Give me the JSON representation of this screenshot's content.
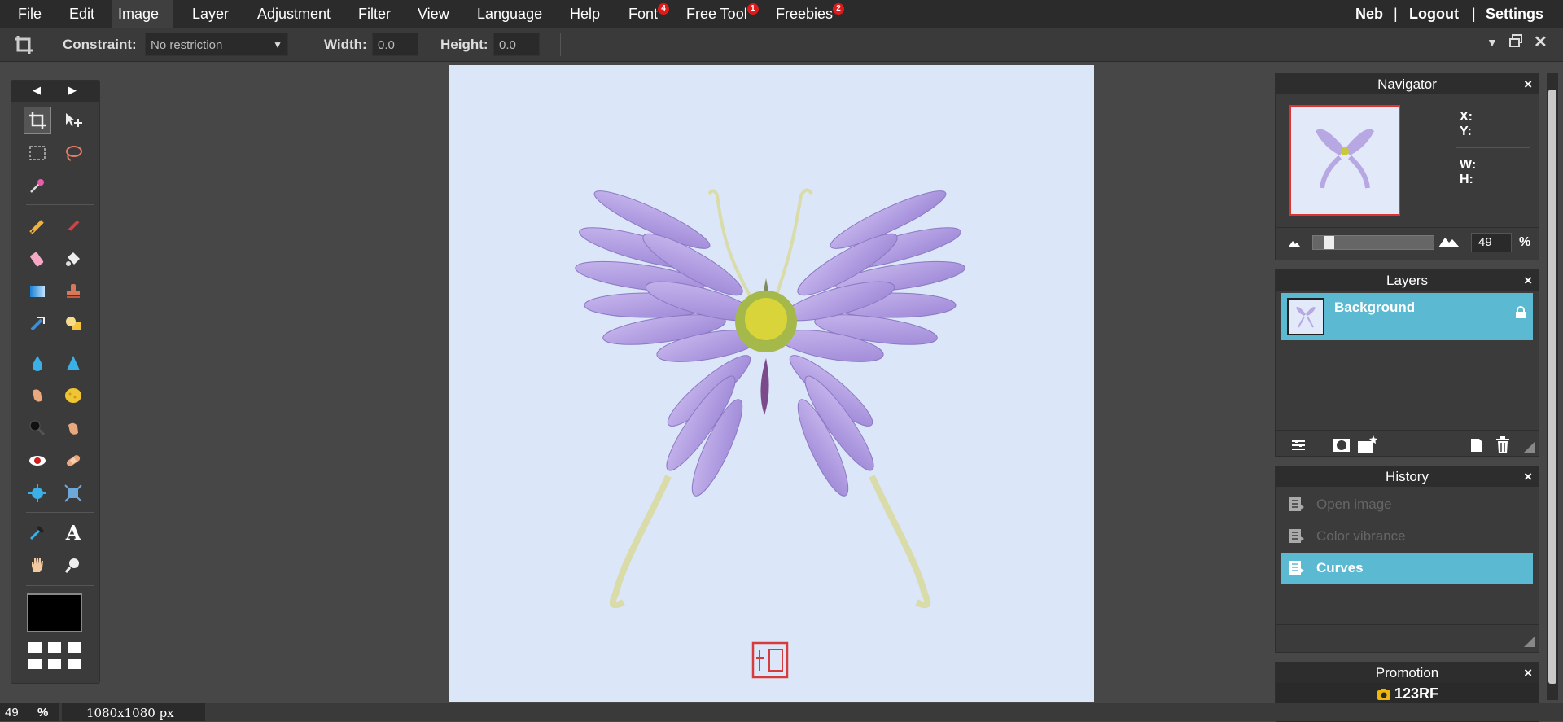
{
  "menu": {
    "items": [
      {
        "label": "File"
      },
      {
        "label": "Edit"
      },
      {
        "label": "Image"
      },
      {
        "label": "Layer"
      },
      {
        "label": "Adjustment"
      },
      {
        "label": "Filter"
      },
      {
        "label": "View"
      },
      {
        "label": "Language"
      },
      {
        "label": "Help"
      },
      {
        "label": "Font",
        "badge": "4"
      },
      {
        "label": "Free Tool",
        "badge": "1"
      },
      {
        "label": "Freebies",
        "badge": "2"
      }
    ],
    "active": "Image",
    "user": "Neb",
    "logout": "Logout",
    "settings": "Settings",
    "separator": "|"
  },
  "options": {
    "constraint_label": "Constraint:",
    "constraint_value": "No restriction",
    "width_label": "Width:",
    "width_value": "0.0",
    "height_label": "Height:",
    "height_value": "0.0"
  },
  "tools": {
    "items": [
      {
        "name": "crop-tool",
        "icon": "crop-icon",
        "active": true
      },
      {
        "name": "move-tool",
        "icon": "move-icon"
      },
      {
        "name": "marquee-tool",
        "icon": "marquee-icon"
      },
      {
        "name": "lasso-tool",
        "icon": "lasso-icon"
      },
      {
        "name": "magic-wand-tool",
        "icon": "magic-wand-icon"
      },
      {
        "name": "pencil-tool",
        "icon": "pencil-icon"
      },
      {
        "name": "brush-tool",
        "icon": "brush-icon"
      },
      {
        "name": "eraser-tool",
        "icon": "eraser-icon"
      },
      {
        "name": "fill-tool",
        "icon": "paint-bucket-icon"
      },
      {
        "name": "gradient-tool",
        "icon": "gradient-icon"
      },
      {
        "name": "clone-stamp-tool",
        "icon": "stamp-icon"
      },
      {
        "name": "color-replace-tool",
        "icon": "color-replace-icon"
      },
      {
        "name": "shape-tool",
        "icon": "shapes-icon"
      },
      {
        "name": "blur-tool",
        "icon": "drop-icon"
      },
      {
        "name": "sharpen-tool",
        "icon": "sharpen-icon"
      },
      {
        "name": "smudge-tool",
        "icon": "smudge-icon"
      },
      {
        "name": "sponge-tool",
        "icon": "sponge-icon"
      },
      {
        "name": "dodge-tool",
        "icon": "dodge-icon"
      },
      {
        "name": "burn-tool",
        "icon": "burn-icon"
      },
      {
        "name": "red-eye-tool",
        "icon": "red-eye-icon"
      },
      {
        "name": "spot-heal-tool",
        "icon": "bandage-icon"
      },
      {
        "name": "bloat-tool",
        "icon": "bloat-icon"
      },
      {
        "name": "pinch-tool",
        "icon": "pinch-icon"
      },
      {
        "name": "color-picker-tool",
        "icon": "eyedropper-icon"
      },
      {
        "name": "type-tool",
        "icon": "type-icon",
        "glyph": "A"
      },
      {
        "name": "hand-tool",
        "icon": "hand-icon"
      },
      {
        "name": "zoom-tool",
        "icon": "zoom-icon"
      }
    ],
    "foreground_color": "#000000"
  },
  "navigator": {
    "title": "Navigator",
    "close": "×",
    "x_label": "X:",
    "y_label": "Y:",
    "w_label": "W:",
    "h_label": "H:",
    "zoom_value": "49",
    "zoom_unit": "%",
    "zoom_fraction": 0.1
  },
  "layers": {
    "title": "Layers",
    "close": "×",
    "items": [
      {
        "name": "Background",
        "locked": true
      }
    ]
  },
  "history": {
    "title": "History",
    "close": "×",
    "items": [
      {
        "label": "Open image",
        "state": "dimmed"
      },
      {
        "label": "Color vibrance",
        "state": "dimmed"
      },
      {
        "label": "Curves",
        "state": "active"
      }
    ]
  },
  "promotion": {
    "title": "Promotion",
    "close": "×",
    "brand": "123RF"
  },
  "status": {
    "zoom": "49",
    "unit": "%",
    "dimensions": "1080x1080 px"
  },
  "colors": {
    "accent": "#5bbad2",
    "badge": "#e01a1a",
    "canvas_bg": "#dbe6f8"
  }
}
